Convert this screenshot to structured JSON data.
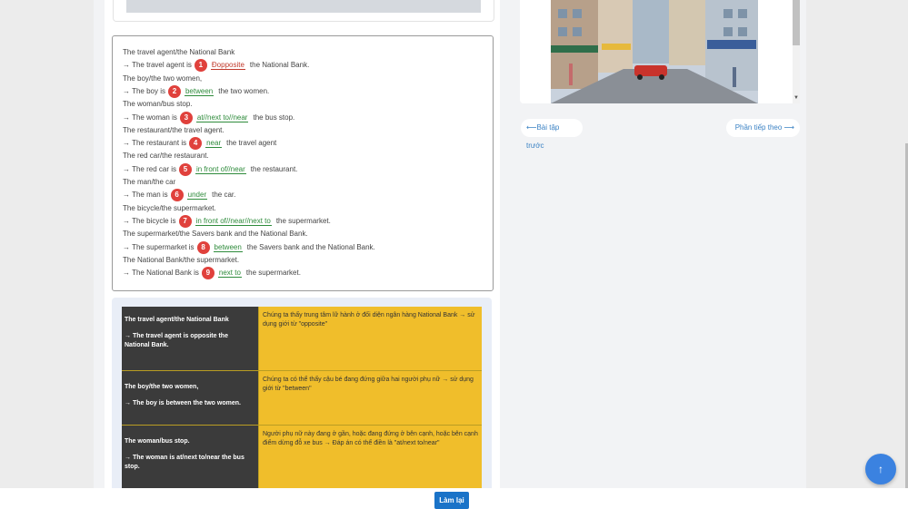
{
  "exercise": {
    "lines": [
      {
        "type": "pair",
        "text": "The travel agent/the National Bank"
      },
      {
        "type": "answer",
        "prefix": "→ The travel agent is",
        "num": "1",
        "answer": "Đopposite",
        "suffix": "the National Bank.",
        "wrong": true
      },
      {
        "type": "pair",
        "text": "The boy/the two women,"
      },
      {
        "type": "answer",
        "prefix": "→ The boy is",
        "num": "2",
        "answer": "between",
        "suffix": "the two women."
      },
      {
        "type": "pair",
        "text": "The woman/bus stop."
      },
      {
        "type": "answer",
        "prefix": "→ The woman is",
        "num": "3",
        "answer": "at//next to//near",
        "suffix": "the bus stop."
      },
      {
        "type": "pair",
        "text": "The restaurant/the travel agent."
      },
      {
        "type": "answer",
        "prefix": "→ The restaurant is",
        "num": "4",
        "answer": "near",
        "suffix": "the travel agent"
      },
      {
        "type": "pair",
        "text": "The red car/the restaurant."
      },
      {
        "type": "answer",
        "prefix": "→ The red car is",
        "num": "5",
        "answer": "in front of//near",
        "suffix": "the restaurant."
      },
      {
        "type": "pair",
        "text": "The man/the car"
      },
      {
        "type": "answer",
        "prefix": "→ The man is",
        "num": "6",
        "answer": "under",
        "suffix": "the car."
      },
      {
        "type": "pair",
        "text": "The bicycle/the supermarket."
      },
      {
        "type": "answer",
        "prefix": "→ The bicycle is",
        "num": "7",
        "answer": "in front of//near//next to",
        "suffix": "the supermarket."
      },
      {
        "type": "pair",
        "text": "The supermarket/the Savers bank and the National Bank."
      },
      {
        "type": "answer",
        "prefix": "→ The supermarket is",
        "num": "8",
        "answer": "between",
        "suffix": "the Savers bank and the National Bank."
      },
      {
        "type": "pair",
        "text": "The National Bank/the supermarket."
      },
      {
        "type": "answer",
        "prefix": "→ The National Bank is",
        "num": "9",
        "answer": "next to",
        "suffix": "the supermarket."
      }
    ]
  },
  "explanations": [
    {
      "left_1": "The travel agent/the National Bank",
      "left_2": "→ The travel agent is opposite the National Bank.",
      "right": "Chúng ta thấy trung tâm lữ hành ở đối diện ngân hàng National Bank → sử dụng giới từ \"opposite\""
    },
    {
      "left_1": "The boy/the two women,",
      "left_2": "→ The boy is between the two women.",
      "right": "Chúng ta có thể thấy cậu bé đang đứng giữa hai người phụ nữ → sử dụng giới từ \"between\""
    },
    {
      "left_1": "The woman/bus stop.",
      "left_2": "→ The woman is at/next to/near the bus stop.",
      "right": "Người phụ nữ này đang ở gần, hoặc đang đứng ở bên cạnh, hoặc bên cạnh điểm dừng đỗ xe bus → Đáp án có thể điền là \"at/next to/near\""
    }
  ],
  "nav": {
    "prev_label": "Bài tập trước",
    "next_label": "Phần tiếp theo"
  },
  "redo_label": "Làm lại",
  "colors": {
    "accent": "#1a73c8",
    "number_badge": "#e0413c",
    "answer": "#2e8b3b",
    "expl_left": "#3b3b3b",
    "expl_right": "#f0be2b"
  },
  "icons": {
    "prev": "arrow-left-icon",
    "next": "arrow-right-icon",
    "float": "arrow-up-icon"
  }
}
